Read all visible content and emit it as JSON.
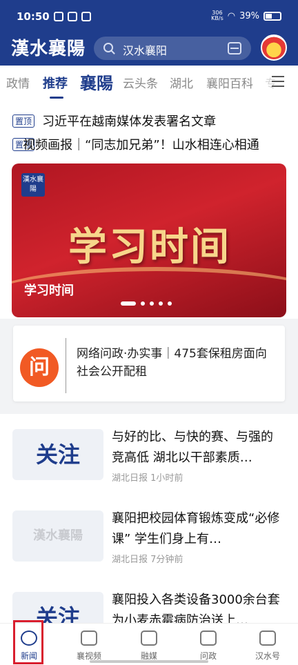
{
  "status_bar": {
    "time": "10:50",
    "net_speed_value": "306",
    "net_speed_unit": "KB/s",
    "battery": "39%"
  },
  "header": {
    "logo_text": "漢水襄陽",
    "search_text": "汉水襄阳"
  },
  "tabs": {
    "items": [
      "政情",
      "推荐",
      "襄陽",
      "云头条",
      "湖北",
      "襄阳百科",
      "专"
    ],
    "active": "推荐"
  },
  "pinned": [
    {
      "badge": "置顶",
      "text": "习近平在越南媒体发表署名文章"
    },
    {
      "badge": "置顶",
      "text": "视频画报｜“同志加兄弟”！山水相连心相通"
    }
  ],
  "banner": {
    "logo_text": "漢水襄陽",
    "headline": "学习时间",
    "caption": "学习时间",
    "dot_count": 5,
    "active_dot": 1
  },
  "wenzheng": {
    "icon_char": "问",
    "text": "网络问政·办实事｜475套保租房面向社会公开配租"
  },
  "news": [
    {
      "thumb": "关注",
      "title": "与好的比、与快的赛、与强的竞高低 湖北以干部素质…",
      "source": "湖北日报",
      "time": "1小时前"
    },
    {
      "thumb": "漢水襄陽",
      "title": "襄阳把校园体育锻炼变成“必修课” 学生们身上有…",
      "source": "湖北日报",
      "time": "7分钟前"
    },
    {
      "thumb": "关注",
      "title": "襄阳投入各类设备3000余台套 为小麦赤霉病防治送上…",
      "source": "",
      "time": ""
    }
  ],
  "bottom_nav": [
    "新闻",
    "襄视频",
    "融媒",
    "问政",
    "汉水号"
  ],
  "bottom_nav_active": "新闻",
  "colors": {
    "brand": "#1f3d8c",
    "accent_red": "#d91e2e",
    "wenzheng_orange": "#f15a24"
  }
}
